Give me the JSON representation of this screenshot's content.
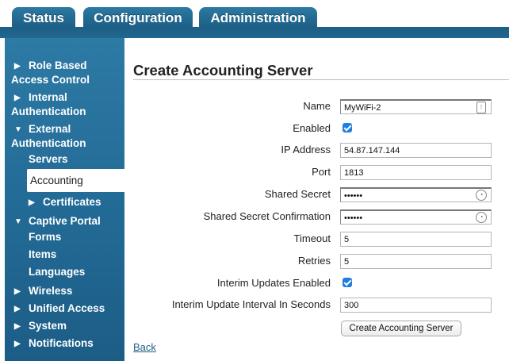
{
  "tabs": [
    "Status",
    "Configuration",
    "Administration"
  ],
  "sidebar": {
    "role_based": "Role Based",
    "access_control": "Access Control",
    "internal": "Internal",
    "internal_auth": "Authentication",
    "external": "External",
    "external_auth": "Authentication",
    "servers": "Servers",
    "accounting": "Accounting",
    "certificates": "Certificates",
    "captive_portal": "Captive Portal",
    "forms": "Forms",
    "items": "Items",
    "languages": "Languages",
    "wireless": "Wireless",
    "unified_access": "Unified Access",
    "system": "System",
    "notifications": "Notifications"
  },
  "page_title": "Create Accounting Server",
  "form": {
    "name_label": "Name",
    "name_value": "MyWiFi-2",
    "enabled_label": "Enabled",
    "ip_label": "IP Address",
    "ip_value": "54.87.147.144",
    "port_label": "Port",
    "port_value": "1813",
    "secret_label": "Shared Secret",
    "secret_value": "••••••",
    "secret_confirm_label": "Shared Secret Confirmation",
    "secret_confirm_value": "••••••",
    "timeout_label": "Timeout",
    "timeout_value": "5",
    "retries_label": "Retries",
    "retries_value": "5",
    "interim_enabled_label": "Interim Updates Enabled",
    "interim_interval_label": "Interim Update Interval In Seconds",
    "interim_interval_value": "300",
    "submit_label": "Create Accounting Server"
  },
  "back_link": "Back"
}
